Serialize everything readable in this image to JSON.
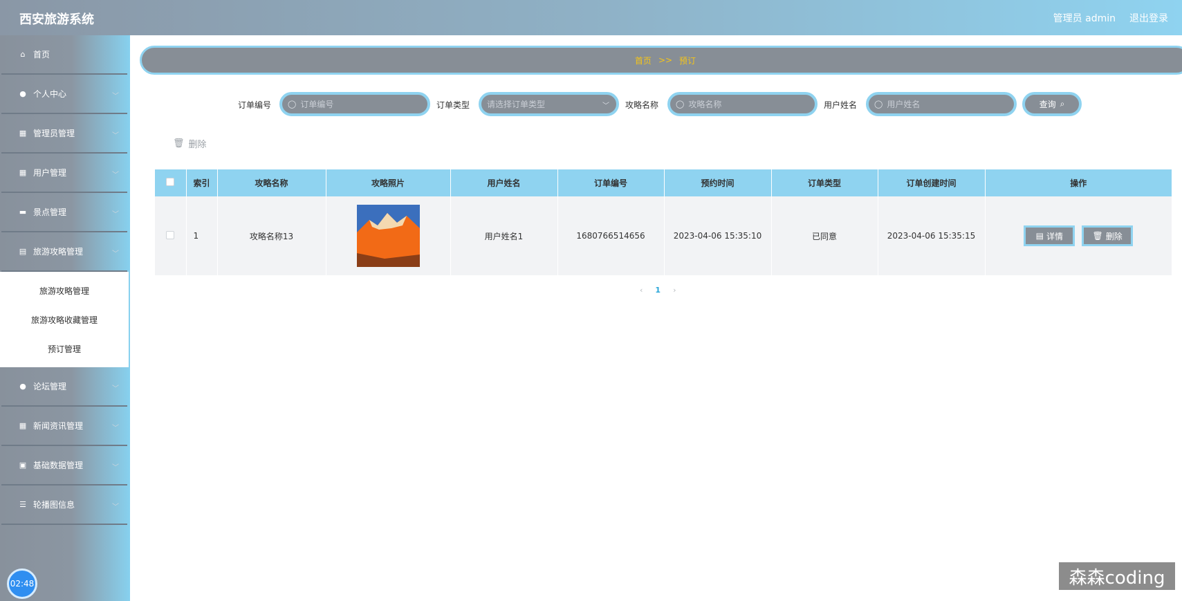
{
  "header": {
    "app_title": "西安旅游系统",
    "user_label": "管理员 admin",
    "logout_label": "退出登录"
  },
  "sidebar": {
    "items": [
      {
        "label": "首页",
        "icon": "home-icon",
        "glyph": "⌂",
        "has_arrow": false
      },
      {
        "label": "个人中心",
        "icon": "user-icon",
        "glyph": "●",
        "has_arrow": true
      },
      {
        "label": "管理员管理",
        "icon": "grid-icon",
        "glyph": "▦",
        "has_arrow": true
      },
      {
        "label": "用户管理",
        "icon": "grid-icon",
        "glyph": "▦",
        "has_arrow": true
      },
      {
        "label": "景点管理",
        "icon": "comment-icon",
        "glyph": "▬",
        "has_arrow": true
      },
      {
        "label": "旅游攻略管理",
        "icon": "document-icon",
        "glyph": "▤",
        "has_arrow": true
      }
    ],
    "submenu": [
      "旅游攻略管理",
      "旅游攻略收藏管理",
      "预订管理"
    ],
    "items_after": [
      {
        "label": "论坛管理",
        "icon": "user-icon",
        "glyph": "●",
        "has_arrow": true
      },
      {
        "label": "新闻资讯管理",
        "icon": "grid-icon",
        "glyph": "▦",
        "has_arrow": true
      },
      {
        "label": "基础数据管理",
        "icon": "briefcase-icon",
        "glyph": "▣",
        "has_arrow": true
      },
      {
        "label": "轮播图信息",
        "icon": "list-icon",
        "glyph": "☰",
        "has_arrow": true
      }
    ],
    "clock": "02:48"
  },
  "breadcrumb": {
    "home": "首页",
    "separator": ">>",
    "current": "预订"
  },
  "search": {
    "order_no_label": "订单编号",
    "order_no_placeholder": "订单编号",
    "order_type_label": "订单类型",
    "order_type_placeholder": "请选择订单类型",
    "guide_name_label": "攻略名称",
    "guide_name_placeholder": "攻略名称",
    "user_name_label": "用户姓名",
    "user_name_placeholder": "用户姓名",
    "query_label": "查询"
  },
  "toolbar": {
    "delete_label": "删除"
  },
  "table": {
    "columns": [
      "索引",
      "攻略名称",
      "攻略照片",
      "用户姓名",
      "订单编号",
      "预约时间",
      "订单类型",
      "订单创建时间",
      "操作"
    ],
    "rows": [
      {
        "index": "1",
        "guide_name": "攻略名称13",
        "user_name": "用户姓名1",
        "order_no": "1680766514656",
        "booking_time": "2023-04-06 15:35:10",
        "order_type": "已同意",
        "created_time": "2023-04-06 15:35:15",
        "detail_label": "详情",
        "delete_label": "删除"
      }
    ]
  },
  "pagination": {
    "current_page": "1"
  },
  "watermark": "森森coding",
  "colors": {
    "accent": "#8fd3f0",
    "control_bg": "#878e96",
    "breadcrumb_text": "#f5c518"
  }
}
